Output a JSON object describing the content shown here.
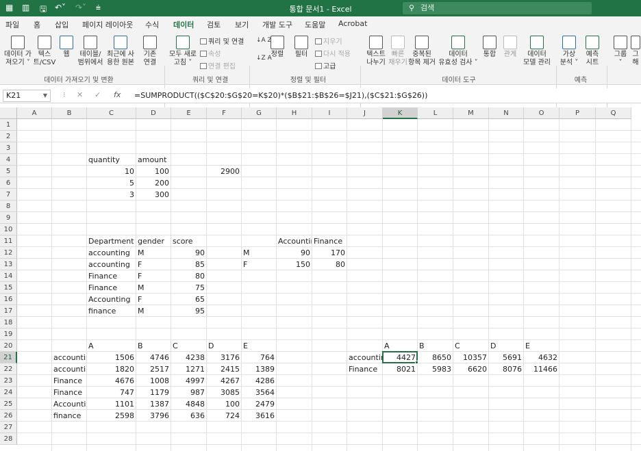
{
  "window": {
    "title": "통합 문서1  -  Excel",
    "search_placeholder": "검색",
    "quick_access": [
      "save-icon",
      "undo-icon",
      "redo-icon",
      "customize-icon"
    ]
  },
  "tabs": [
    {
      "label": "파일"
    },
    {
      "label": "홈"
    },
    {
      "label": "삽입"
    },
    {
      "label": "페이지 레이아웃"
    },
    {
      "label": "수식"
    },
    {
      "label": "데이터",
      "active": true
    },
    {
      "label": "검토"
    },
    {
      "label": "보기"
    },
    {
      "label": "개발 도구"
    },
    {
      "label": "도움말"
    },
    {
      "label": "Acrobat"
    }
  ],
  "ribbon": {
    "get_data": {
      "line1": "데이터 가",
      "line2": "져오기 ˅"
    },
    "text_csv": {
      "line1": "텍스",
      "line2": "트/CSV"
    },
    "web": {
      "line1": "웹",
      "line2": ""
    },
    "from_table": {
      "line1": "테이블/",
      "line2": "범위에서"
    },
    "recent_sources": {
      "line1": "최근에 사",
      "line2": "용한 원본"
    },
    "existing_connections": {
      "line1": "기존",
      "line2": "연결"
    },
    "refresh_all": {
      "line1": "모두 새로",
      "line2": "고침 ˅"
    },
    "queries_connections": "쿼리 및 연결",
    "properties": "속성",
    "edit_links": "연결 편집",
    "sort_asc": "↓A Z",
    "sort_desc": "↓Z A",
    "sort": "정렬",
    "filter": "필터",
    "clear": "지우기",
    "reapply": "다시 적용",
    "advanced": "고급",
    "text_to_columns": {
      "line1": "텍스트",
      "line2": "나누기"
    },
    "flash_fill": {
      "line1": "빠른",
      "line2": "채우기"
    },
    "remove_duplicates": {
      "line1": "중복된",
      "line2": "항목 제거"
    },
    "data_validation": {
      "line1": "데이터",
      "line2": "유효성 검사 ˅"
    },
    "consolidate": {
      "line1": "통합",
      "line2": ""
    },
    "relationships": {
      "line1": "관계",
      "line2": ""
    },
    "data_model": {
      "line1": "데이터",
      "line2": "모델 관리"
    },
    "what_if": {
      "line1": "가상",
      "line2": "분석 ˅"
    },
    "forecast_sheet": {
      "line1": "예측",
      "line2": "시트"
    },
    "group": {
      "line1": "그룹",
      "line2": "˅"
    },
    "ungroup": {
      "line1": "그",
      "line2": "해"
    },
    "groups": {
      "get_transform": "데이터 가져오기 및 변환",
      "queries": "쿼리 및 연결",
      "sort_filter": "정렬 및 필터",
      "data_tools": "데이터 도구",
      "forecast": "예측"
    }
  },
  "formula_bar": {
    "name_box": "K21",
    "fx": "fx",
    "formula": "=SUMPRODUCT(($C$20:$G$20=K$20)*($B$21:$B$26=$J21),($C$21:$G$26))"
  },
  "columns": [
    "A",
    "B",
    "C",
    "D",
    "E",
    "F",
    "G",
    "H",
    "I",
    "J",
    "K",
    "L",
    "M",
    "N",
    "O",
    "P",
    "Q"
  ],
  "rows": [
    "1",
    "2",
    "3",
    "4",
    "5",
    "6",
    "7",
    "8",
    "9",
    "10",
    "11",
    "12",
    "13",
    "14",
    "15",
    "16",
    "17",
    "18",
    "19",
    "20",
    "21",
    "22",
    "23",
    "24",
    "25",
    "26",
    "27",
    "28"
  ],
  "selected": {
    "col": "K",
    "row": 21
  },
  "cells": [
    {
      "r": 4,
      "c": "C",
      "v": "quantity",
      "t": "txt"
    },
    {
      "r": 4,
      "c": "D",
      "v": "amount",
      "t": "txt"
    },
    {
      "r": 5,
      "c": "C",
      "v": "10",
      "t": "num"
    },
    {
      "r": 5,
      "c": "D",
      "v": "100",
      "t": "num"
    },
    {
      "r": 5,
      "c": "F",
      "v": "2900",
      "t": "num"
    },
    {
      "r": 6,
      "c": "C",
      "v": "5",
      "t": "num"
    },
    {
      "r": 6,
      "c": "D",
      "v": "200",
      "t": "num"
    },
    {
      "r": 7,
      "c": "C",
      "v": "3",
      "t": "num"
    },
    {
      "r": 7,
      "c": "D",
      "v": "300",
      "t": "num"
    },
    {
      "r": 11,
      "c": "C",
      "v": "Department",
      "t": "txt"
    },
    {
      "r": 11,
      "c": "D",
      "v": "gender",
      "t": "txt"
    },
    {
      "r": 11,
      "c": "E",
      "v": "score",
      "t": "txt"
    },
    {
      "r": 11,
      "c": "H",
      "v": "Accountir",
      "t": "txt"
    },
    {
      "r": 11,
      "c": "I",
      "v": "Finance",
      "t": "txt"
    },
    {
      "r": 12,
      "c": "C",
      "v": "accounting",
      "t": "txt"
    },
    {
      "r": 12,
      "c": "D",
      "v": "M",
      "t": "txt"
    },
    {
      "r": 12,
      "c": "E",
      "v": "90",
      "t": "num"
    },
    {
      "r": 12,
      "c": "G",
      "v": "M",
      "t": "txt"
    },
    {
      "r": 12,
      "c": "H",
      "v": "90",
      "t": "num"
    },
    {
      "r": 12,
      "c": "I",
      "v": "170",
      "t": "num"
    },
    {
      "r": 13,
      "c": "C",
      "v": "accounting",
      "t": "txt"
    },
    {
      "r": 13,
      "c": "D",
      "v": "F",
      "t": "txt"
    },
    {
      "r": 13,
      "c": "E",
      "v": "85",
      "t": "num"
    },
    {
      "r": 13,
      "c": "G",
      "v": "F",
      "t": "txt"
    },
    {
      "r": 13,
      "c": "H",
      "v": "150",
      "t": "num"
    },
    {
      "r": 13,
      "c": "I",
      "v": "80",
      "t": "num"
    },
    {
      "r": 14,
      "c": "C",
      "v": "Finance",
      "t": "txt"
    },
    {
      "r": 14,
      "c": "D",
      "v": "F",
      "t": "txt"
    },
    {
      "r": 14,
      "c": "E",
      "v": "80",
      "t": "num"
    },
    {
      "r": 15,
      "c": "C",
      "v": "Finance",
      "t": "txt"
    },
    {
      "r": 15,
      "c": "D",
      "v": "M",
      "t": "txt"
    },
    {
      "r": 15,
      "c": "E",
      "v": "75",
      "t": "num"
    },
    {
      "r": 16,
      "c": "C",
      "v": "Accounting",
      "t": "txt"
    },
    {
      "r": 16,
      "c": "D",
      "v": "F",
      "t": "txt"
    },
    {
      "r": 16,
      "c": "E",
      "v": "65",
      "t": "num"
    },
    {
      "r": 17,
      "c": "C",
      "v": "finance",
      "t": "txt"
    },
    {
      "r": 17,
      "c": "D",
      "v": "M",
      "t": "txt"
    },
    {
      "r": 17,
      "c": "E",
      "v": "95",
      "t": "num"
    },
    {
      "r": 20,
      "c": "C",
      "v": "A",
      "t": "txt"
    },
    {
      "r": 20,
      "c": "D",
      "v": "B",
      "t": "txt"
    },
    {
      "r": 20,
      "c": "E",
      "v": "C",
      "t": "txt"
    },
    {
      "r": 20,
      "c": "F",
      "v": "D",
      "t": "txt"
    },
    {
      "r": 20,
      "c": "G",
      "v": "E",
      "t": "txt"
    },
    {
      "r": 20,
      "c": "K",
      "v": "A",
      "t": "txt"
    },
    {
      "r": 20,
      "c": "L",
      "v": "B",
      "t": "txt"
    },
    {
      "r": 20,
      "c": "M",
      "v": "C",
      "t": "txt"
    },
    {
      "r": 20,
      "c": "N",
      "v": "D",
      "t": "txt"
    },
    {
      "r": 20,
      "c": "O",
      "v": "E",
      "t": "txt"
    },
    {
      "r": 21,
      "c": "B",
      "v": "accountin",
      "t": "txt"
    },
    {
      "r": 21,
      "c": "C",
      "v": "1506",
      "t": "num"
    },
    {
      "r": 21,
      "c": "D",
      "v": "4746",
      "t": "num"
    },
    {
      "r": 21,
      "c": "E",
      "v": "4238",
      "t": "num"
    },
    {
      "r": 21,
      "c": "F",
      "v": "3176",
      "t": "num"
    },
    {
      "r": 21,
      "c": "G",
      "v": "764",
      "t": "num"
    },
    {
      "r": 21,
      "c": "J",
      "v": "accountir",
      "t": "txt"
    },
    {
      "r": 21,
      "c": "K",
      "v": "4427",
      "t": "num"
    },
    {
      "r": 21,
      "c": "L",
      "v": "8650",
      "t": "num"
    },
    {
      "r": 21,
      "c": "M",
      "v": "10357",
      "t": "num"
    },
    {
      "r": 21,
      "c": "N",
      "v": "5691",
      "t": "num"
    },
    {
      "r": 21,
      "c": "O",
      "v": "4632",
      "t": "num"
    },
    {
      "r": 22,
      "c": "B",
      "v": "accountin",
      "t": "txt"
    },
    {
      "r": 22,
      "c": "C",
      "v": "1820",
      "t": "num"
    },
    {
      "r": 22,
      "c": "D",
      "v": "2517",
      "t": "num"
    },
    {
      "r": 22,
      "c": "E",
      "v": "1271",
      "t": "num"
    },
    {
      "r": 22,
      "c": "F",
      "v": "2415",
      "t": "num"
    },
    {
      "r": 22,
      "c": "G",
      "v": "1389",
      "t": "num"
    },
    {
      "r": 22,
      "c": "J",
      "v": "Finance",
      "t": "txt"
    },
    {
      "r": 22,
      "c": "K",
      "v": "8021",
      "t": "num"
    },
    {
      "r": 22,
      "c": "L",
      "v": "5983",
      "t": "num"
    },
    {
      "r": 22,
      "c": "M",
      "v": "6620",
      "t": "num"
    },
    {
      "r": 22,
      "c": "N",
      "v": "8076",
      "t": "num"
    },
    {
      "r": 22,
      "c": "O",
      "v": "11466",
      "t": "num"
    },
    {
      "r": 23,
      "c": "B",
      "v": "Finance",
      "t": "txt"
    },
    {
      "r": 23,
      "c": "C",
      "v": "4676",
      "t": "num"
    },
    {
      "r": 23,
      "c": "D",
      "v": "1008",
      "t": "num"
    },
    {
      "r": 23,
      "c": "E",
      "v": "4997",
      "t": "num"
    },
    {
      "r": 23,
      "c": "F",
      "v": "4267",
      "t": "num"
    },
    {
      "r": 23,
      "c": "G",
      "v": "4286",
      "t": "num"
    },
    {
      "r": 24,
      "c": "B",
      "v": "Finance",
      "t": "txt"
    },
    {
      "r": 24,
      "c": "C",
      "v": "747",
      "t": "num"
    },
    {
      "r": 24,
      "c": "D",
      "v": "1179",
      "t": "num"
    },
    {
      "r": 24,
      "c": "E",
      "v": "987",
      "t": "num"
    },
    {
      "r": 24,
      "c": "F",
      "v": "3085",
      "t": "num"
    },
    {
      "r": 24,
      "c": "G",
      "v": "3564",
      "t": "num"
    },
    {
      "r": 25,
      "c": "B",
      "v": "Accountir",
      "t": "txt"
    },
    {
      "r": 25,
      "c": "C",
      "v": "1101",
      "t": "num"
    },
    {
      "r": 25,
      "c": "D",
      "v": "1387",
      "t": "num"
    },
    {
      "r": 25,
      "c": "E",
      "v": "4848",
      "t": "num"
    },
    {
      "r": 25,
      "c": "F",
      "v": "100",
      "t": "num"
    },
    {
      "r": 25,
      "c": "G",
      "v": "2479",
      "t": "num"
    },
    {
      "r": 26,
      "c": "B",
      "v": "finance",
      "t": "txt"
    },
    {
      "r": 26,
      "c": "C",
      "v": "2598",
      "t": "num"
    },
    {
      "r": 26,
      "c": "D",
      "v": "3796",
      "t": "num"
    },
    {
      "r": 26,
      "c": "E",
      "v": "636",
      "t": "num"
    },
    {
      "r": 26,
      "c": "F",
      "v": "724",
      "t": "num"
    },
    {
      "r": 26,
      "c": "G",
      "v": "3616",
      "t": "num"
    }
  ],
  "colors": {
    "accent": "#217346",
    "grid": "#e1e1e1",
    "header_bg": "#efefef"
  }
}
